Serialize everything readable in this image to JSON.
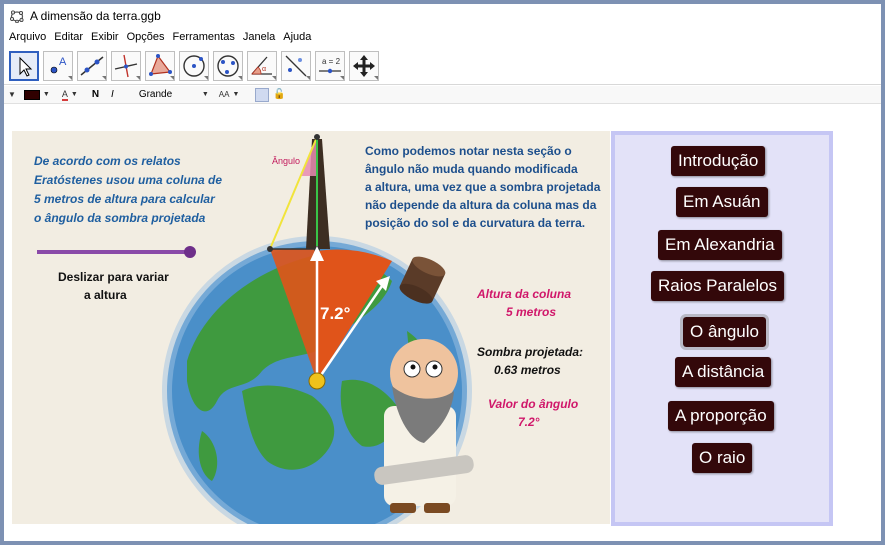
{
  "window": {
    "title": "A dimensão da terra.ggb"
  },
  "menu": [
    "Arquivo",
    "Editar",
    "Exibir",
    "Opções",
    "Ferramentas",
    "Janela",
    "Ajuda"
  ],
  "toolbar": {
    "tools": [
      {
        "name": "move-tool-icon"
      },
      {
        "name": "point-tool-icon"
      },
      {
        "name": "line-tool-icon"
      },
      {
        "name": "perpendicular-tool-icon"
      },
      {
        "name": "polygon-tool-icon"
      },
      {
        "name": "circle-tool-icon"
      },
      {
        "name": "conic-tool-icon"
      },
      {
        "name": "angle-tool-icon"
      },
      {
        "name": "reflect-tool-icon"
      },
      {
        "name": "slider-tool-icon"
      },
      {
        "name": "move-view-tool-icon"
      }
    ],
    "slider_tool_label": "a = 2"
  },
  "stylebar": {
    "color": "#300000",
    "bold": "N",
    "italic": "I",
    "text_size": "Grande",
    "font_size_icon": "AA"
  },
  "scene": {
    "intro_text": [
      "De acordo com os relatos",
      "Eratóstenes usou uma coluna de",
      "5 metros de altura para calcular",
      "o ângulo da sombra projetada"
    ],
    "note_text": [
      "Como podemos notar nesta seção o",
      "ângulo não muda quando modificada",
      "a altura, uma vez que a sombra projetada",
      "não depende da altura da coluna mas da",
      "posição do sol e da curvatura da terra."
    ],
    "slider_caption": [
      "Deslizar para variar",
      "a altura"
    ],
    "slider_value": 1.0,
    "angle_small_label": "Ângulo",
    "angle_big": "7.2°",
    "column_height_title": "Altura da coluna",
    "column_height_value": "5 metros",
    "shadow_title": "Sombra projetada:",
    "shadow_value": "0.63 metros",
    "angle_title": "Valor do ângulo",
    "angle_value": "7.2°",
    "colors": {
      "sky": "#f2ede2",
      "ocean": "#4a8fc9",
      "land": "#3f9a3f",
      "sector": "#e0541a",
      "slider": "#8a4aa8"
    }
  },
  "nav": {
    "buttons": [
      {
        "label": "Introdução"
      },
      {
        "label": "Em Asuán"
      },
      {
        "label": "Em Alexandria"
      },
      {
        "label": "Raios Paralelos"
      },
      {
        "label": "O ângulo",
        "active": true
      },
      {
        "label": "A distância"
      },
      {
        "label": "A proporção"
      },
      {
        "label": "O raio"
      }
    ]
  }
}
